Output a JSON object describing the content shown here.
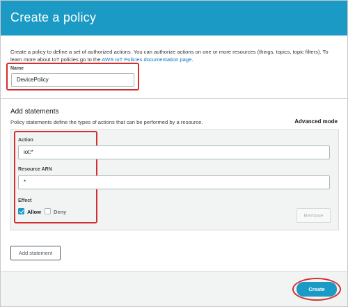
{
  "header": {
    "title": "Create a policy"
  },
  "intro": {
    "text": "Create a policy to define a set of authorized actions. You can authorize actions on one or more resources (things, topics, topic filters). To learn more about IoT policies go to the ",
    "link": "AWS IoT Policies documentation page",
    "suffix": "."
  },
  "name_field": {
    "label": "Name",
    "value": "DevicePolicy"
  },
  "statements": {
    "title": "Add statements",
    "description": "Policy statements define the types of actions that can be performed by a resource.",
    "advanced_mode": "Advanced mode",
    "action": {
      "label": "Action",
      "value": "iot:*"
    },
    "resource_arn": {
      "label": "Resource ARN",
      "value": "*"
    },
    "effect": {
      "label": "Effect",
      "allow_label": "Allow",
      "deny_label": "Deny",
      "allow_checked": true,
      "deny_checked": false
    },
    "remove_label": "Remove",
    "add_statement_label": "Add statement"
  },
  "footer": {
    "create_label": "Create"
  },
  "colors": {
    "primary": "#1a9ac4",
    "highlight_annotation": "#d13030",
    "link": "#0073bb"
  },
  "icons": {
    "allow_checkbox": "checkbox-checked-icon",
    "deny_checkbox": "checkbox-unchecked-icon"
  }
}
